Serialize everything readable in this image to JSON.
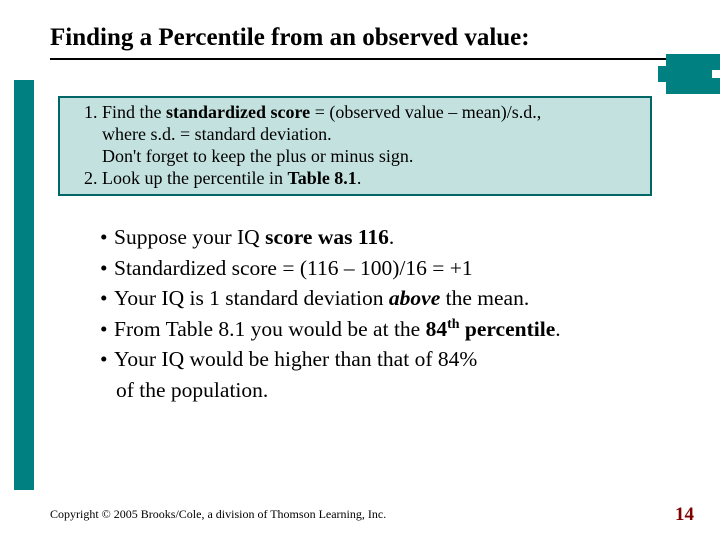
{
  "title": "Finding a Percentile from an observed value:",
  "box": {
    "item1_a": "Find the ",
    "item1_bold": "standardized score",
    "item1_b": " = (observed value – mean)/s.d.,",
    "item1_line2": "where s.d. = standard deviation.",
    "item1_line3": "Don't forget to keep the plus or minus sign.",
    "item2_a": "Look up the percentile in ",
    "item2_bold": "Table 8.1",
    "item2_b": "."
  },
  "bullets": {
    "b1_a": "Suppose your IQ ",
    "b1_bold": "score was 116",
    "b1_b": ".",
    "b2": "Standardized score = (116 – 100)/16 = +1",
    "b3_a": "Your IQ is 1 standard deviation ",
    "b3_bold": "above",
    "b3_b": " the mean.",
    "b4_a": "From Table 8.1 you would be at the ",
    "b4_bold_a": "84",
    "b4_sup": "th",
    "b4_bold_b": " percentile",
    "b4_b": ".",
    "b5_line1": "Your IQ would be higher than that of 84%",
    "b5_line2": "of the population."
  },
  "footer": "Copyright © 2005 Brooks/Cole, a division of Thomson Learning, Inc.",
  "page": "14"
}
